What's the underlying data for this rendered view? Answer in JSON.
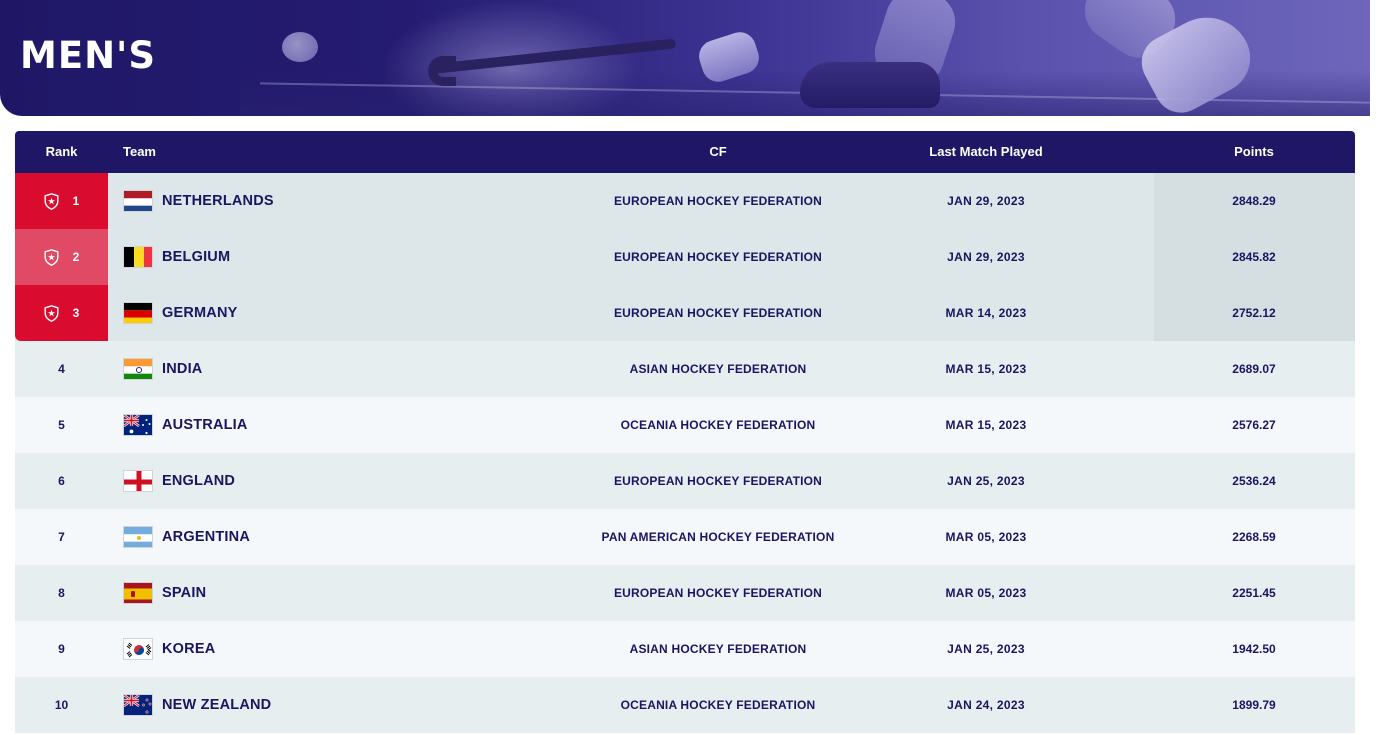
{
  "section_title": "MEN'S",
  "table": {
    "headers": {
      "rank": "Rank",
      "team": "Team",
      "cf": "CF",
      "last_match": "Last Match Played",
      "points": "Points"
    },
    "rows": [
      {
        "rank": "1",
        "team": "NETHERLANDS",
        "flag": "netherlands-flag-icon",
        "cf": "EUROPEAN HOCKEY FEDERATION",
        "last_match": "JAN 29, 2023",
        "points": "2848.29"
      },
      {
        "rank": "2",
        "team": "BELGIUM",
        "flag": "belgium-flag-icon",
        "cf": "EUROPEAN HOCKEY FEDERATION",
        "last_match": "JAN 29, 2023",
        "points": "2845.82"
      },
      {
        "rank": "3",
        "team": "GERMANY",
        "flag": "germany-flag-icon",
        "cf": "EUROPEAN HOCKEY FEDERATION",
        "last_match": "MAR 14, 2023",
        "points": "2752.12"
      },
      {
        "rank": "4",
        "team": "INDIA",
        "flag": "india-flag-icon",
        "cf": "ASIAN HOCKEY FEDERATION",
        "last_match": "MAR 15, 2023",
        "points": "2689.07"
      },
      {
        "rank": "5",
        "team": "AUSTRALIA",
        "flag": "australia-flag-icon",
        "cf": "OCEANIA HOCKEY FEDERATION",
        "last_match": "MAR 15, 2023",
        "points": "2576.27"
      },
      {
        "rank": "6",
        "team": "ENGLAND",
        "flag": "england-flag-icon",
        "cf": "EUROPEAN HOCKEY FEDERATION",
        "last_match": "JAN 25, 2023",
        "points": "2536.24"
      },
      {
        "rank": "7",
        "team": "ARGENTINA",
        "flag": "argentina-flag-icon",
        "cf": "PAN AMERICAN HOCKEY FEDERATION",
        "last_match": "MAR 05, 2023",
        "points": "2268.59"
      },
      {
        "rank": "8",
        "team": "SPAIN",
        "flag": "spain-flag-icon",
        "cf": "EUROPEAN HOCKEY FEDERATION",
        "last_match": "MAR 05, 2023",
        "points": "2251.45"
      },
      {
        "rank": "9",
        "team": "KOREA",
        "flag": "korea-flag-icon",
        "cf": "ASIAN HOCKEY FEDERATION",
        "last_match": "JAN 25, 2023",
        "points": "1942.50"
      },
      {
        "rank": "10",
        "team": "NEW ZEALAND",
        "flag": "new-zealand-flag-icon",
        "cf": "OCEANIA HOCKEY FEDERATION",
        "last_match": "JAN 24, 2023",
        "points": "1899.79"
      }
    ]
  },
  "colors": {
    "header_bg": "#1f1766",
    "medal_red": "#d90b2e",
    "medal_pink": "#e04a64",
    "text": "#1a1560"
  },
  "icons": {
    "medal": "star-shield-icon"
  }
}
